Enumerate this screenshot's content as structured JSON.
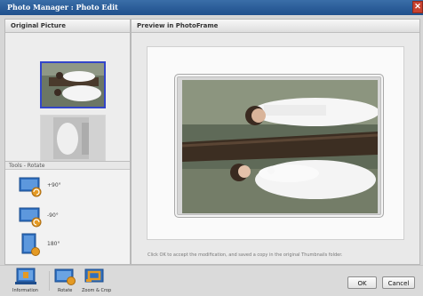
{
  "window": {
    "title": "Photo Manager : Photo Edit",
    "close_glyph": "✕"
  },
  "left_panel": {
    "header": "Original Picture",
    "tools_header": "Tools - Rotate",
    "tools": [
      {
        "label": "+90°",
        "icon": "rotate-plus-90-icon"
      },
      {
        "label": "-90°",
        "icon": "rotate-minus-90-icon"
      },
      {
        "label": "180°",
        "icon": "rotate-180-icon"
      }
    ]
  },
  "right_panel": {
    "header": "Preview in PhotoFrame",
    "note": "Click OK to accept the modification, and saved a copy in the original Thumbnails folder."
  },
  "bottom_bar": {
    "tabs": [
      {
        "label": "Information",
        "icon": "information-icon"
      },
      {
        "label": "Rotate",
        "icon": "rotate-icon"
      },
      {
        "label": "Zoom & Crop",
        "icon": "zoom-crop-icon"
      }
    ],
    "ok_label": "OK",
    "cancel_label": "Cancel"
  },
  "colors": {
    "title_bar": "#2a5d9a",
    "selection": "#3346c9",
    "tool_blue": "#2f6fc0",
    "tool_orange": "#e49a24"
  }
}
